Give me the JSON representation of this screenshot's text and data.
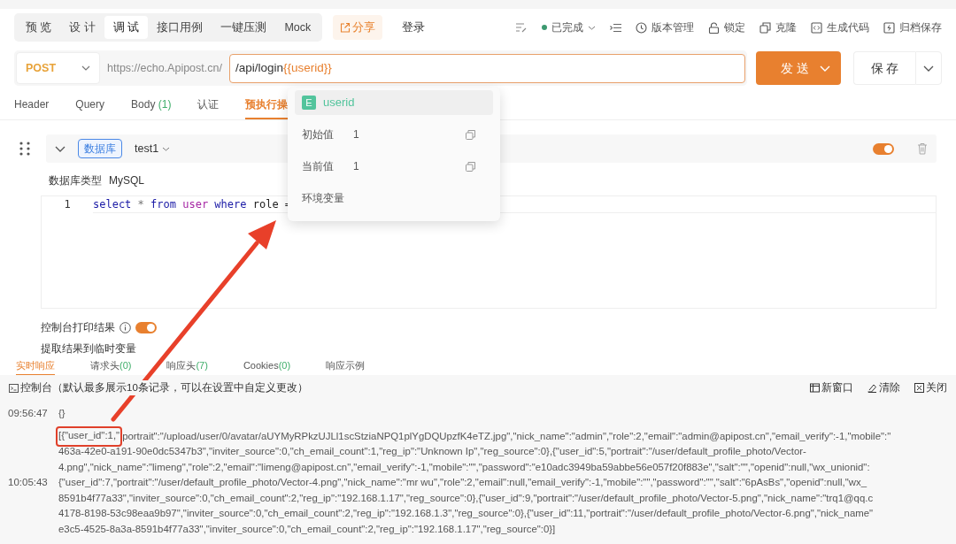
{
  "mode_tabs": [
    {
      "label": "预 览",
      "selected": false
    },
    {
      "label": "设 计",
      "selected": false
    },
    {
      "label": "调 试",
      "selected": true
    },
    {
      "label": "接口用例",
      "selected": false
    },
    {
      "label": "一键压测",
      "selected": false
    },
    {
      "label": "Mock",
      "selected": false
    }
  ],
  "share_button": "分享",
  "api_name": "登录",
  "status": {
    "label": "已完成",
    "color": "#3d9970"
  },
  "actions": [
    {
      "kind": "history",
      "label": "版本管理"
    },
    {
      "kind": "lock",
      "label": "锁定"
    },
    {
      "kind": "clone",
      "label": "克隆"
    },
    {
      "kind": "code",
      "label": "生成代码"
    },
    {
      "kind": "archive",
      "label": "归档保存"
    }
  ],
  "request": {
    "method": "POST",
    "base_url": "https://echo.Apipost.cn/",
    "path": "/api/login",
    "variable": "{{userid}}",
    "send_button": "发 送",
    "save_button": "保 存"
  },
  "request_tabs": [
    {
      "label": "Header",
      "selected": false
    },
    {
      "label": "Query",
      "selected": false
    },
    {
      "label": "Body",
      "count": "(1)",
      "selected": false
    },
    {
      "label": "认证",
      "selected": false
    },
    {
      "label": "预执行操",
      "selected": true
    }
  ],
  "script": {
    "type_badge": "数据库",
    "connection": "test1",
    "enabled": true,
    "db_type_label": "数据库类型",
    "db_type": "MySQL",
    "code_lines": [
      {
        "number": "1",
        "tokens": [
          {
            "kind": "keyword",
            "text": "select"
          },
          {
            "kind": "operator",
            "text": "*"
          },
          {
            "kind": "keyword",
            "text": "from"
          },
          {
            "kind": "builtin",
            "text": "user"
          },
          {
            "kind": "keyword",
            "text": "where"
          },
          {
            "kind": "plain",
            "text": "role"
          },
          {
            "kind": "plain",
            "text": "="
          }
        ]
      }
    ],
    "console_print": {
      "label": "控制台打印结果",
      "on": true
    },
    "extract_label": "提取结果到临时变量"
  },
  "variable_popup": {
    "badge": "E",
    "name": "userid",
    "rows": [
      {
        "label": "初始值",
        "value": "1"
      },
      {
        "label": "当前值",
        "value": "1"
      }
    ],
    "scope": "环境变量"
  },
  "response_tabs": [
    {
      "label": "实时响应",
      "selected": true
    },
    {
      "label": "请求头",
      "count": "(0)",
      "selected": false
    },
    {
      "label": "响应头",
      "count": "(7)",
      "selected": false
    },
    {
      "label": "Cookies",
      "count": "(0)",
      "selected": false
    },
    {
      "label": "响应示例",
      "selected": false
    }
  ],
  "console": {
    "title": "控制台（默认最多展示10条记录，可以在设置中自定义更改）",
    "actions": [
      {
        "kind": "window",
        "label": "新窗口"
      },
      {
        "kind": "clear",
        "label": "清除"
      },
      {
        "kind": "close",
        "label": "关闭"
      }
    ],
    "entries": [
      {
        "time": "09:56:47",
        "lines": [
          "{}"
        ]
      },
      {
        "time": "10:05:43",
        "lines": [
          {
            "boxed": "[{\"user_id\":1,\"",
            "text": "portrait\":\"/upload/user/0/avatar/aUYMyRPkzUJLl1scStziaNPQ1plYgDQUpzfK4eTZ.jpg\",\"nick_name\":\"admin\",\"role\":2,\"email\":\"admin@apipost.cn\",\"email_verify\":-1,\"mobile\":\""
          },
          "463a-42e0-a191-90e0dc5347b3\",\"inviter_source\":0,\"ch_email_count\":1,\"reg_ip\":\"Unknown Ip\",\"reg_source\":0},{\"user_id\":5,\"portrait\":\"/user/default_profile_photo/Vector-",
          "4.png\",\"nick_name\":\"limeng\",\"role\":2,\"email\":\"limeng@apipost.cn\",\"email_verify\":-1,\"mobile\":\"\",\"password\":\"e10adc3949ba59abbe56e057f20f883e\",\"salt\":\"\",\"openid\":null,\"wx_unionid\":",
          "{\"user_id\":7,\"portrait\":\"/user/default_profile_photo/Vector-4.png\",\"nick_name\":\"mr wu\",\"role\":2,\"email\":null,\"email_verify\":-1,\"mobile\":\"\",\"password\":\"\",\"salt\":\"6pAsBs\",\"openid\":null,\"wx_",
          "8591b4f77a33\",\"inviter_source\":0,\"ch_email_count\":2,\"reg_ip\":\"192.168.1.17\",\"reg_source\":0},{\"user_id\":9,\"portrait\":\"/user/default_profile_photo/Vector-5.png\",\"nick_name\":\"trq1@qq.c",
          "4178-8198-53c98eaa9b97\",\"inviter_source\":0,\"ch_email_count\":2,\"reg_ip\":\"192.168.1.3\",\"reg_source\":0},{\"user_id\":11,\"portrait\":\"/user/default_profile_photo/Vector-6.png\",\"nick_name\"",
          "e3c5-4525-8a3a-8591b4f77a33\",\"inviter_source\":0,\"ch_email_count\":2,\"reg_ip\":\"192.168.1.17\",\"reg_source\":0}]"
        ]
      }
    ]
  }
}
